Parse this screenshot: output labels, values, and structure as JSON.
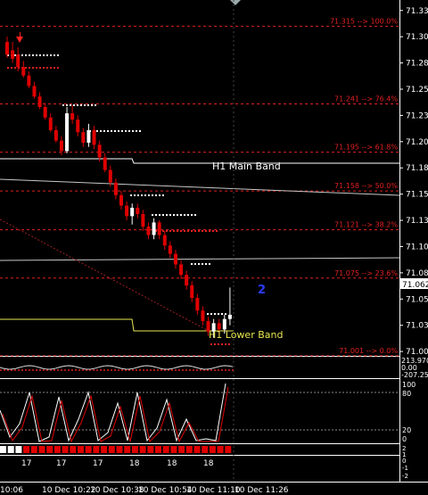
{
  "colors": {
    "background": "#000000",
    "axis": "#ffffff",
    "fib": "#e02020",
    "bear_candle": "#e00000",
    "bull_candle": "#ffffff",
    "band_main": "#ffffff",
    "band_lower": "#e8e850",
    "wave_label": "#2b3cff"
  },
  "price_axis": {
    "ticks": [
      "71.330",
      "71.305",
      "71.280",
      "71.255",
      "71.230",
      "71.205",
      "71.180",
      "71.155",
      "71.130",
      "71.105",
      "71.080",
      "71.055",
      "71.030",
      "71.005"
    ],
    "current_price": "71.062",
    "range": [
      71.0,
      71.34
    ]
  },
  "fib_levels": [
    {
      "price": 71.315,
      "label": "71.315 --> 100.0%"
    },
    {
      "price": 71.241,
      "label": "71.241 --> 76.4%"
    },
    {
      "price": 71.195,
      "label": "71.195 --> 61.8%"
    },
    {
      "price": 71.158,
      "label": "71.158 --> 50.0%"
    },
    {
      "price": 71.121,
      "label": "71.121 --> 38.2%"
    },
    {
      "price": 71.075,
      "label": "71.075 --> 23.6%"
    },
    {
      "price": 71.001,
      "label": "71.001 --> 0.0%"
    }
  ],
  "bands": {
    "main_label": "H1 Main Band",
    "lower_label": "H1 Lower Band"
  },
  "wave_label": "2",
  "indicator1": {
    "ticks": [
      "213.970",
      "0.00",
      "-207.254"
    ]
  },
  "indicator2": {
    "ticks": [
      "100",
      "80",
      "20",
      "0"
    ]
  },
  "indicator3": {
    "ticks": [
      "2",
      "1",
      "0",
      "-1",
      "-2"
    ]
  },
  "bar_labels": [
    "17",
    "17",
    "17",
    "18",
    "18",
    "18",
    "18"
  ],
  "time_axis": [
    "10:06",
    "10 Dec 10:22",
    "10 Dec 10:38",
    "10 Dec 10:54",
    "10 Dec 11:10",
    "10 Dec 11:26"
  ],
  "chart_data": {
    "type": "candlestick",
    "symbol_units": "price",
    "bars": [
      [
        71.3,
        71.305,
        71.285,
        71.288
      ],
      [
        71.292,
        71.3,
        71.28,
        71.284
      ],
      [
        71.288,
        71.295,
        71.272,
        71.276
      ],
      [
        71.276,
        71.282,
        71.266,
        71.268
      ],
      [
        71.268,
        71.272,
        71.256,
        71.258
      ],
      [
        71.258,
        71.262,
        71.246,
        71.248
      ],
      [
        71.248,
        71.252,
        71.236,
        71.238
      ],
      [
        71.238,
        71.242,
        71.226,
        71.228
      ],
      [
        71.228,
        71.232,
        71.214,
        71.216
      ],
      [
        71.216,
        71.22,
        71.204,
        71.206
      ],
      [
        71.206,
        71.21,
        71.192,
        71.196
      ],
      [
        71.196,
        71.238,
        71.194,
        71.232
      ],
      [
        71.232,
        71.24,
        71.222,
        71.226
      ],
      [
        71.226,
        71.23,
        71.21,
        71.214
      ],
      [
        71.214,
        71.218,
        71.2,
        71.204
      ],
      [
        71.204,
        71.222,
        71.2,
        71.216
      ],
      [
        71.216,
        71.22,
        71.198,
        71.202
      ],
      [
        71.202,
        71.206,
        71.186,
        71.19
      ],
      [
        71.19,
        71.194,
        71.176,
        71.178
      ],
      [
        71.178,
        71.182,
        71.162,
        71.166
      ],
      [
        71.166,
        71.17,
        71.15,
        71.154
      ],
      [
        71.154,
        71.158,
        71.14,
        71.144
      ],
      [
        71.144,
        71.148,
        71.13,
        71.134
      ],
      [
        71.134,
        71.146,
        71.126,
        71.142
      ],
      [
        71.142,
        71.146,
        71.132,
        71.136
      ],
      [
        71.136,
        71.14,
        71.12,
        71.124
      ],
      [
        71.124,
        71.128,
        71.112,
        71.116
      ],
      [
        71.116,
        71.132,
        71.112,
        71.128
      ],
      [
        71.128,
        71.13,
        71.112,
        71.116
      ],
      [
        71.116,
        71.12,
        71.102,
        71.106
      ],
      [
        71.106,
        71.11,
        71.094,
        71.098
      ],
      [
        71.098,
        71.102,
        71.084,
        71.088
      ],
      [
        71.088,
        71.092,
        71.074,
        71.078
      ],
      [
        71.078,
        71.082,
        71.064,
        71.068
      ],
      [
        71.068,
        71.072,
        71.052,
        71.056
      ],
      [
        71.056,
        71.06,
        71.04,
        71.044
      ],
      [
        71.044,
        71.048,
        71.03,
        71.034
      ],
      [
        71.034,
        71.038,
        71.02,
        71.024
      ],
      [
        71.024,
        71.036,
        71.018,
        71.032
      ],
      [
        71.032,
        71.036,
        71.022,
        71.026
      ],
      [
        71.026,
        71.04,
        71.022,
        71.036
      ],
      [
        71.036,
        71.066,
        71.03,
        71.04
      ]
    ]
  }
}
